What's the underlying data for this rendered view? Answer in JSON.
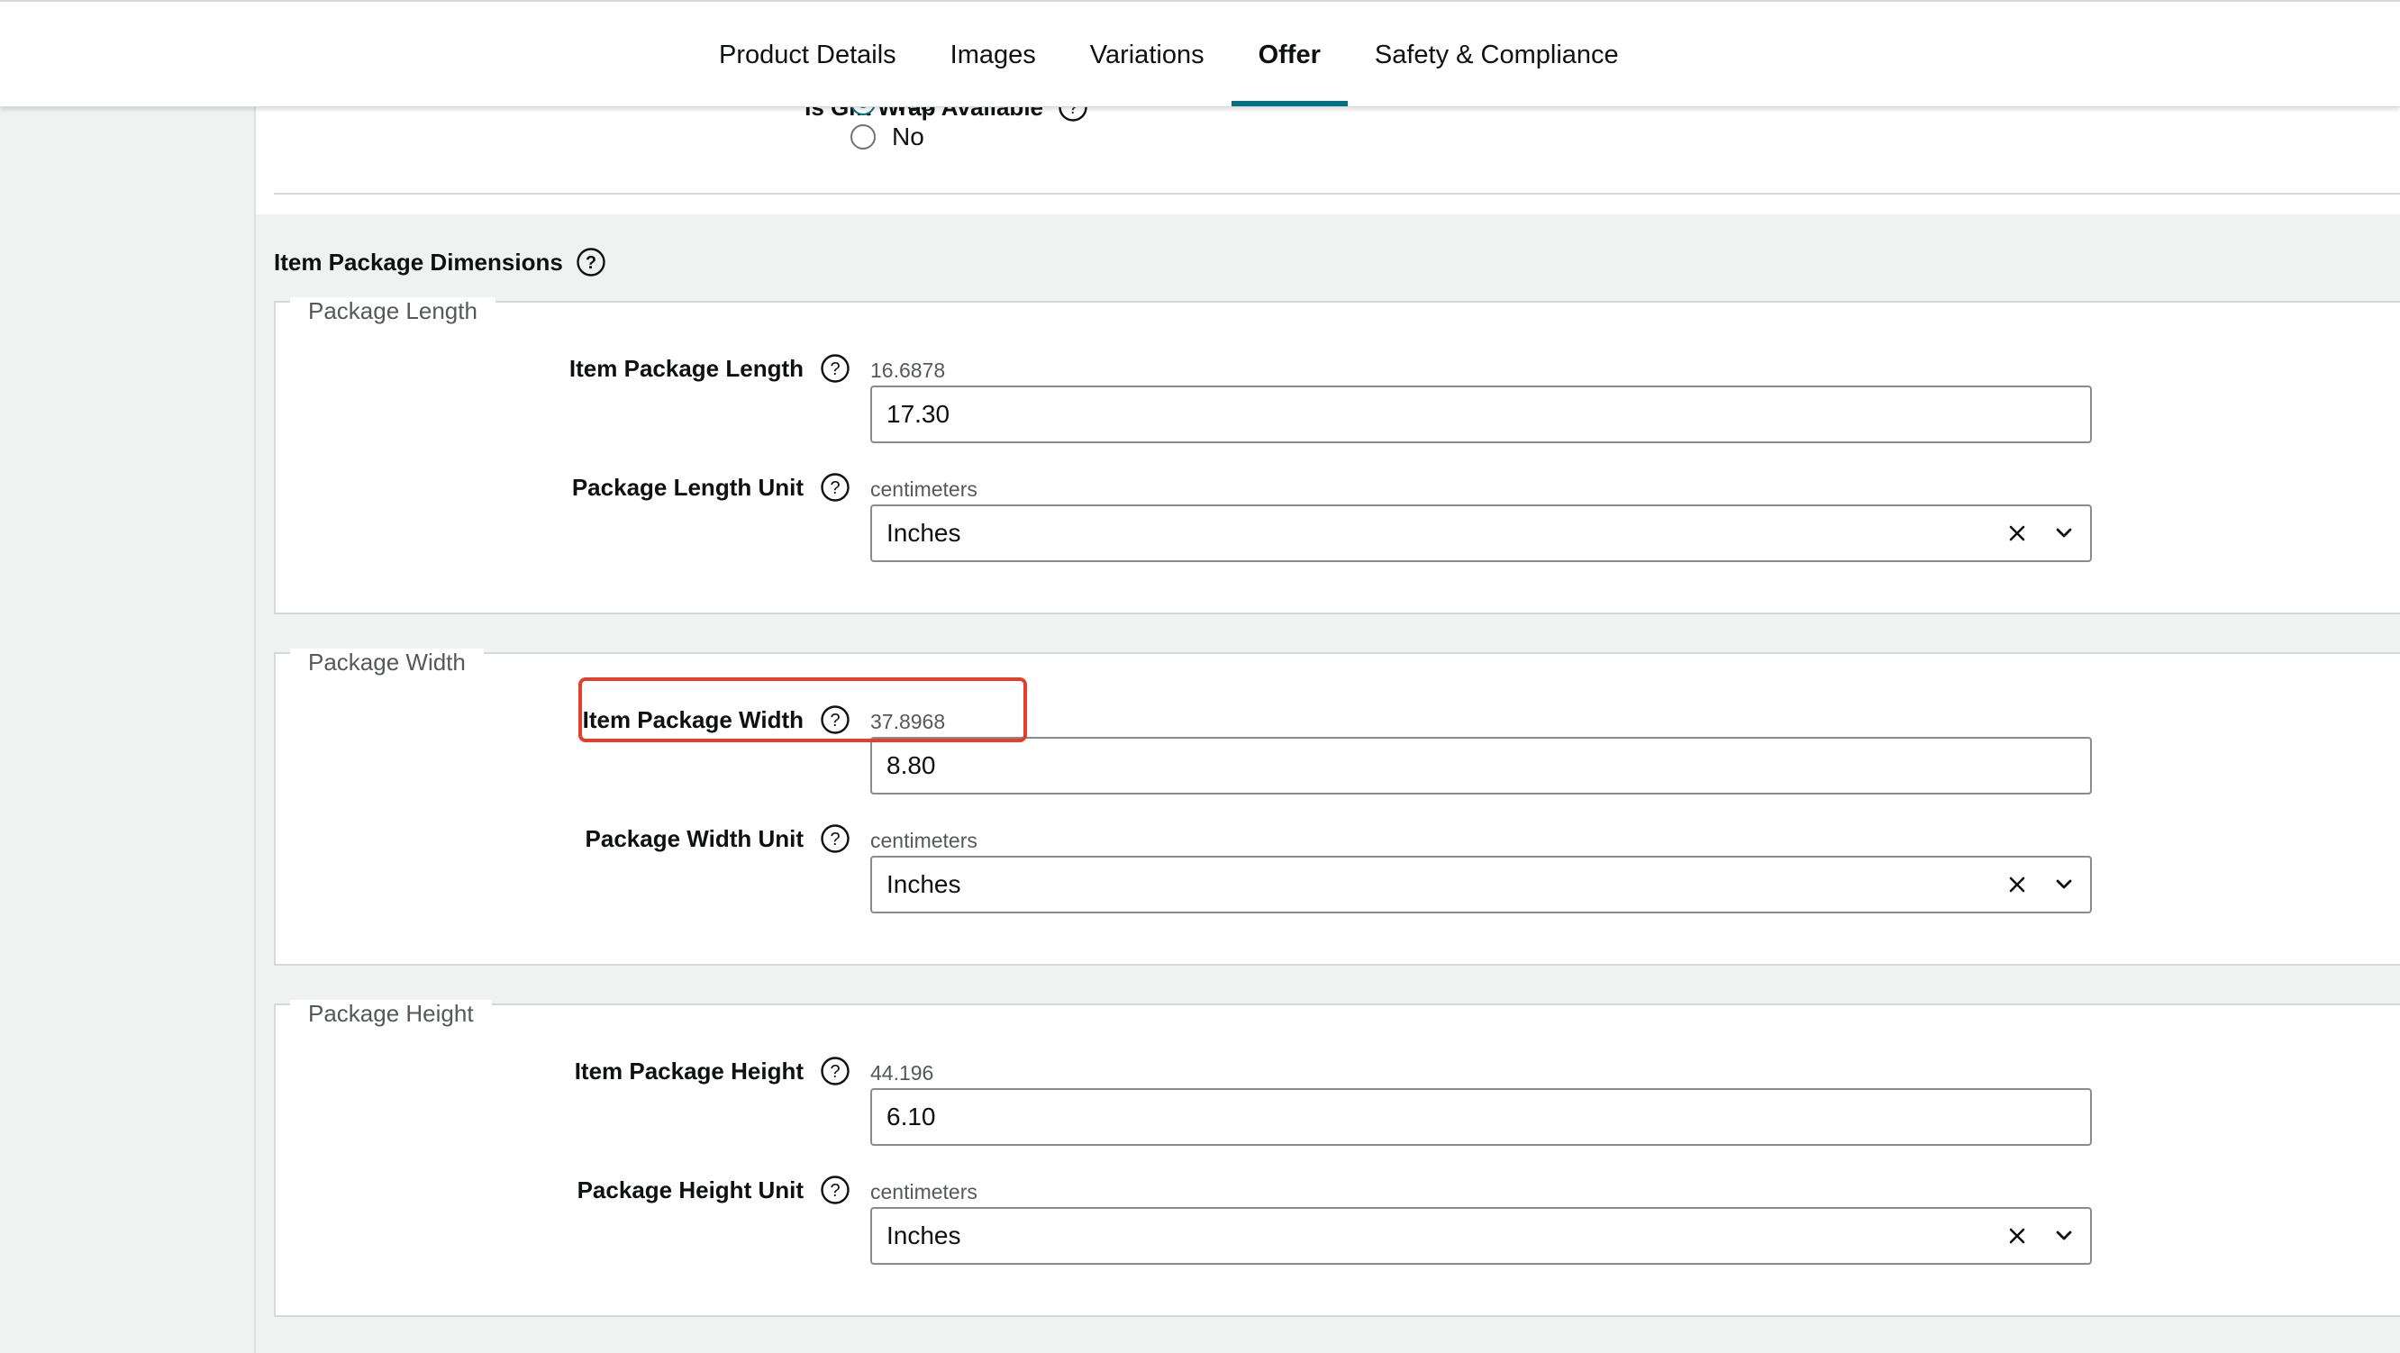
{
  "tabs": [
    {
      "label": "Product Details",
      "active": false
    },
    {
      "label": "Images",
      "active": false
    },
    {
      "label": "Variations",
      "active": false
    },
    {
      "label": "Offer",
      "active": true
    },
    {
      "label": "Safety & Compliance",
      "active": false
    }
  ],
  "gift_wrap": {
    "label": "Is Gift Wrap Available",
    "options": [
      {
        "label": "Yes",
        "selected": true
      },
      {
        "label": "No",
        "selected": false
      }
    ]
  },
  "dimensions": {
    "title": "Item Package Dimensions",
    "length": {
      "legend": "Package Length",
      "value_label": "Item Package Length",
      "value_hint": "16.6878",
      "value": "17.30",
      "unit_label": "Package Length Unit",
      "unit_hint": "centimeters",
      "unit": "Inches"
    },
    "width": {
      "legend": "Package Width",
      "value_label": "Item Package Width",
      "value_hint": "37.8968",
      "value": "8.80",
      "unit_label": "Package Width Unit",
      "unit_hint": "centimeters",
      "unit": "Inches"
    },
    "height": {
      "legend": "Package Height",
      "value_label": "Item Package Height",
      "value_hint": "44.196",
      "value": "6.10",
      "unit_label": "Package Height Unit",
      "unit_hint": "centimeters",
      "unit": "Inches"
    }
  },
  "colors": {
    "accent": "#007185",
    "highlight": "#e2402c",
    "section_bg": "#f0f2f2"
  },
  "icons": [
    "help-icon",
    "clear-icon",
    "chevron-down-icon",
    "radio-icon"
  ]
}
